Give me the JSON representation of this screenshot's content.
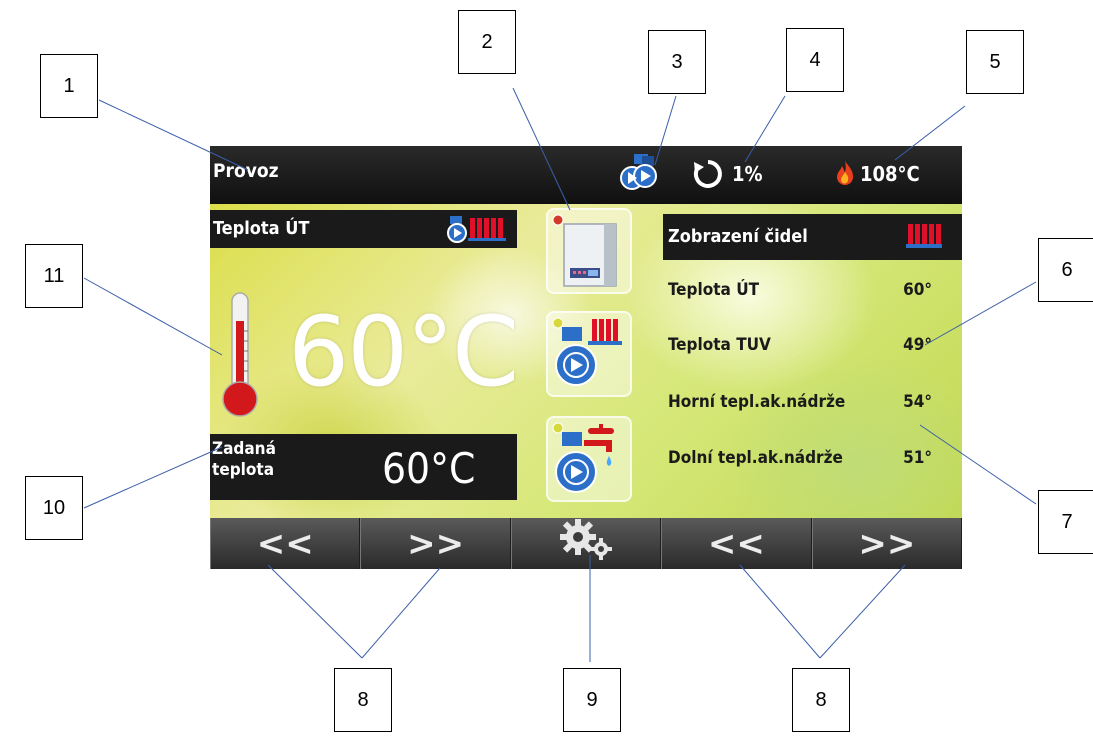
{
  "topbar": {
    "title": "Provoz",
    "percent": "1%",
    "boiler_temp": "108°C"
  },
  "left_panel": {
    "header": "Teplota ÚT",
    "current_temp": "60°C",
    "set_label_line1": "Zadaná",
    "set_label_line2": "teplota",
    "set_temp": "60°C"
  },
  "right_panel": {
    "header": "Zobrazení čidel",
    "sensors": [
      {
        "label": "Teplota ÚT",
        "value": "60°"
      },
      {
        "label": "Teplota TUV",
        "value": "49°"
      },
      {
        "label": "Horní tepl.ak.nádrže",
        "value": "54°"
      },
      {
        "label": "Dolní tepl.ak.nádrže",
        "value": "51°"
      }
    ]
  },
  "bottombar": {
    "prev": "<<",
    "next": ">>",
    "prev2": "<<",
    "next2": ">>"
  },
  "callouts": [
    "1",
    "2",
    "3",
    "4",
    "5",
    "6",
    "7",
    "8",
    "9",
    "8",
    "10",
    "11"
  ],
  "colors": {
    "panel_dark": "#1a1a1a",
    "background_green": "#d7e87a",
    "radiator_red": "#e0102a",
    "pump_blue": "#2b6fc9"
  },
  "icons": [
    "pump-icon",
    "refresh-icon",
    "fire-icon",
    "radiator-icon",
    "thermometer-icon",
    "boiler-icon",
    "heating-pump-icon",
    "water-pump-icon",
    "gears-icon"
  ]
}
